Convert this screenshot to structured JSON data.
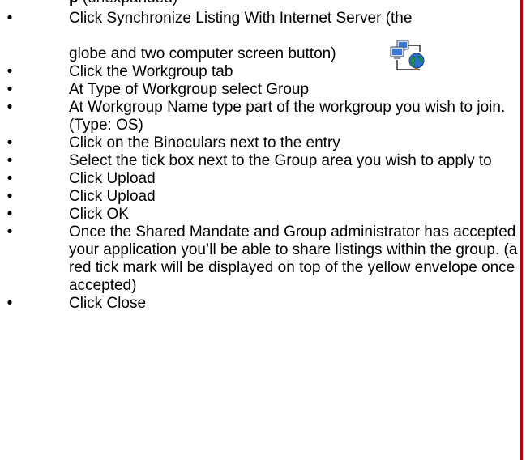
{
  "top_clip": {
    "bold": "p",
    "rest": " (unexpanded)"
  },
  "steps": [
    {
      "line1": "Click Synchronize Listing With Internet Server (the",
      "line2": "globe and two computer screen button)"
    },
    {
      "text": "Click the Workgroup tab"
    },
    {
      "text": "At Type of Workgroup select Group"
    },
    {
      "text": "At Workgroup Name type part of the workgroup you wish to join. (Type: OS)"
    },
    {
      "text": "Click on the Binoculars next to the entry"
    },
    {
      "text": "Select the tick box next to the Group area you wish to apply to"
    },
    {
      "text": "Click Upload"
    },
    {
      "text": "Click Upload"
    },
    {
      "text": "Click OK"
    },
    {
      "text": "Once the Shared Mandate and Group administrator has accepted your application you’ll be able to share listings within the group. (a red tick mark will be displayed on top of the yellow envelope once accepted)"
    },
    {
      "text": "Click Close"
    }
  ],
  "bullet_char": "•",
  "icons": {
    "sync_button": "globe-two-computers-icon"
  },
  "colors": {
    "rule": "#c00000",
    "globe": "#1a8a3a",
    "screen": "#3a78d8"
  }
}
